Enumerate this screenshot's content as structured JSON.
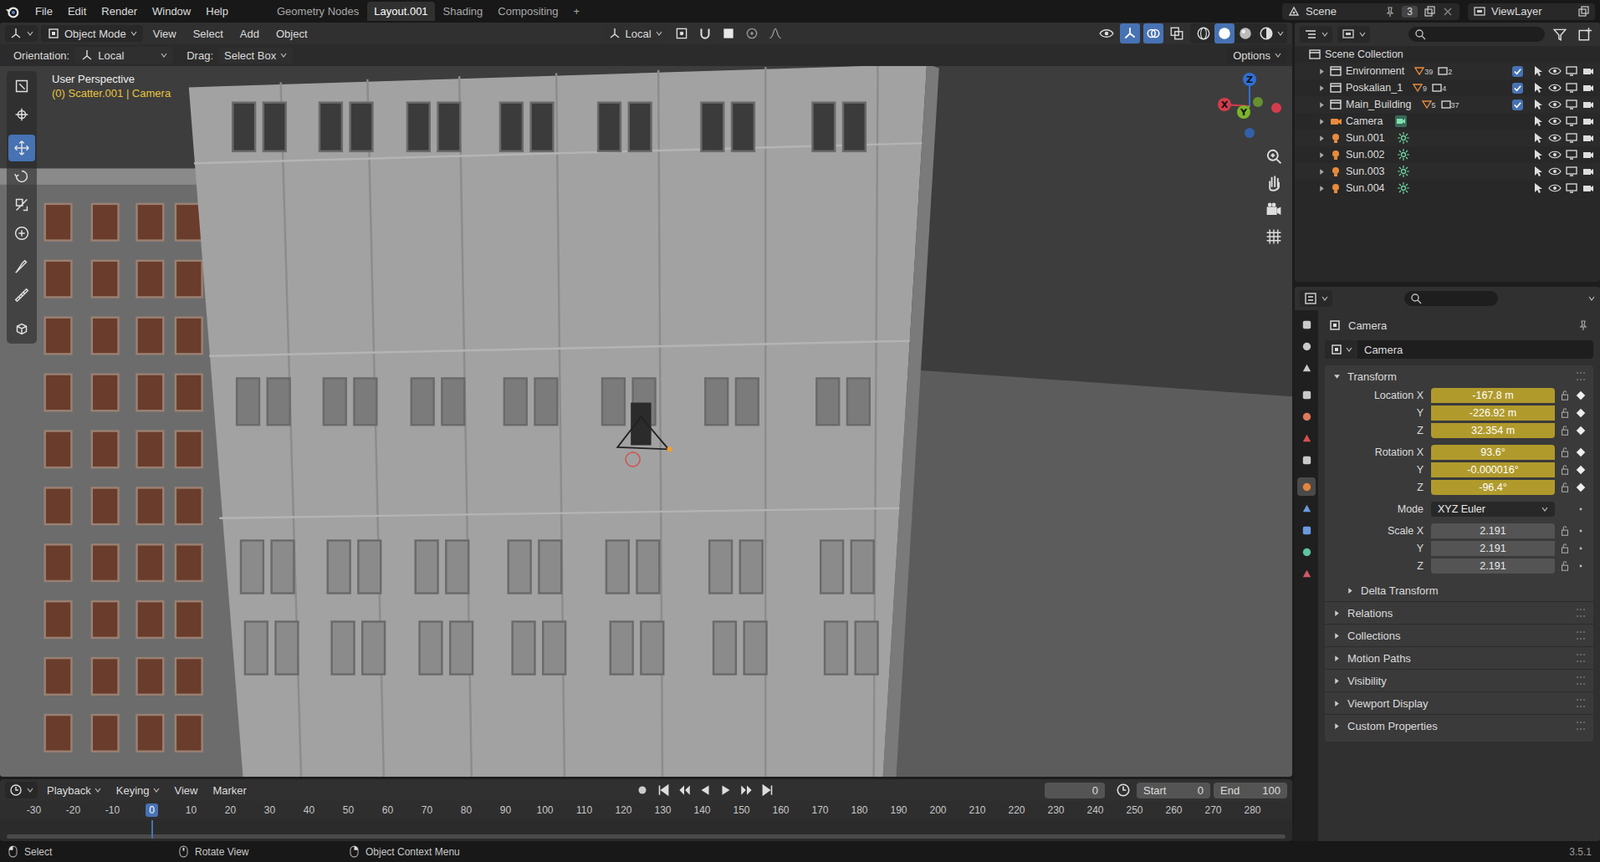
{
  "menu": [
    "File",
    "Edit",
    "Render",
    "Window",
    "Help"
  ],
  "workspaces": [
    {
      "label": "Geometry Nodes",
      "selected": false
    },
    {
      "label": "Layout.001",
      "selected": true
    },
    {
      "label": "Shading",
      "selected": false
    },
    {
      "label": "Compositing",
      "selected": false
    }
  ],
  "workspace_add": "+",
  "scene": {
    "label": "Scene",
    "count": "3",
    "view_layer": "ViewLayer"
  },
  "viewport_header": {
    "mode": "Object Mode",
    "menus": [
      "View",
      "Select",
      "Add",
      "Object"
    ],
    "orientation": "Local"
  },
  "tool_settings": {
    "orientation_label": "Orientation:",
    "orientation": "Local",
    "drag_label": "Drag:",
    "drag": "Select Box",
    "options": "Options"
  },
  "viewport": {
    "perspective": "User Perspective",
    "context": "(0) Scatter.001 | Camera",
    "axes": [
      "X",
      "Y",
      "Z"
    ]
  },
  "tools": [
    {
      "selected": false
    },
    {
      "selected": false
    },
    {
      "selected": true
    },
    {
      "selected": false
    },
    {
      "selected": false
    },
    {
      "selected": false
    },
    {
      "selected": false
    },
    {
      "selected": false
    },
    {
      "selected": false
    }
  ],
  "outliner": {
    "root": "Scene Collection",
    "items": [
      {
        "name": "Environment",
        "kind": "collection",
        "badges": [
          "39",
          "2"
        ],
        "checked": true
      },
      {
        "name": "Poskalian_1",
        "kind": "collection",
        "badges": [
          "9",
          "4"
        ],
        "checked": true
      },
      {
        "name": "Main_Building",
        "kind": "collection",
        "badges": [
          "5",
          "37"
        ],
        "checked": true
      },
      {
        "name": "Camera",
        "kind": "camera",
        "badges": []
      },
      {
        "name": "Sun.001",
        "kind": "light",
        "badges": []
      },
      {
        "name": "Sun.002",
        "kind": "light",
        "badges": []
      },
      {
        "name": "Sun.003",
        "kind": "light",
        "badges": []
      },
      {
        "name": "Sun.004",
        "kind": "light",
        "badges": []
      }
    ]
  },
  "properties": {
    "object": "Camera",
    "datablock": "Camera",
    "prop_tabs": [
      {
        "selected": false
      },
      {
        "selected": false
      },
      {
        "selected": false
      },
      {
        "selected": false
      },
      {
        "selected": false
      },
      {
        "selected": false
      },
      {
        "selected": false
      },
      {
        "selected": true
      },
      {
        "selected": false
      },
      {
        "selected": false
      },
      {
        "selected": false
      },
      {
        "selected": false
      }
    ],
    "transform": {
      "title": "Transform",
      "expanded": true,
      "groups": [
        {
          "rows": [
            {
              "label": "Location X",
              "value": "-167.8 m",
              "kind": "field",
              "animated": true
            },
            {
              "label": "Y",
              "value": "-226.92 m",
              "kind": "field",
              "animated": true
            },
            {
              "label": "Z",
              "value": "32.354 m",
              "kind": "field",
              "animated": true
            }
          ]
        },
        {
          "rows": [
            {
              "label": "Rotation X",
              "value": "93.6°",
              "kind": "field",
              "animated": true
            },
            {
              "label": "Y",
              "value": "-0.000016°",
              "kind": "field",
              "animated": true
            },
            {
              "label": "Z",
              "value": "-96.4°",
              "kind": "field",
              "animated": true
            }
          ]
        },
        {
          "rows": [
            {
              "label": "Mode",
              "value": "XYZ Euler",
              "kind": "dropdown",
              "animated": false
            }
          ]
        },
        {
          "rows": [
            {
              "label": "Scale X",
              "value": "2.191",
              "kind": "field",
              "animated": false
            },
            {
              "label": "Y",
              "value": "2.191",
              "kind": "field",
              "animated": false
            },
            {
              "label": "Z",
              "value": "2.191",
              "kind": "field",
              "animated": false
            }
          ]
        }
      ]
    },
    "sections": [
      {
        "label": "Delta Transform",
        "expanded": false,
        "sub": true
      },
      {
        "label": "Relations",
        "expanded": false,
        "sub": false
      },
      {
        "label": "Collections",
        "expanded": false,
        "sub": false
      },
      {
        "label": "Motion Paths",
        "expanded": false,
        "sub": false
      },
      {
        "label": "Visibility",
        "expanded": false,
        "sub": false
      },
      {
        "label": "Viewport Display",
        "expanded": false,
        "sub": false
      },
      {
        "label": "Custom Properties",
        "expanded": false,
        "sub": false
      }
    ]
  },
  "timeline": {
    "menus": [
      "Playback",
      "Keying",
      "View",
      "Marker"
    ],
    "current_frame": "0",
    "start_label": "Start",
    "start": "0",
    "end_label": "End",
    "end": "100",
    "ruler": [
      {
        "label": "-30",
        "selected": false
      },
      {
        "label": "-20",
        "selected": false
      },
      {
        "label": "-10",
        "selected": false
      },
      {
        "label": "0",
        "selected": true
      },
      {
        "label": "10",
        "selected": false
      },
      {
        "label": "20",
        "selected": false
      },
      {
        "label": "30",
        "selected": false
      },
      {
        "label": "40",
        "selected": false
      },
      {
        "label": "50",
        "selected": false
      },
      {
        "label": "60",
        "selected": false
      },
      {
        "label": "70",
        "selected": false
      },
      {
        "label": "80",
        "selected": false
      },
      {
        "label": "90",
        "selected": false
      },
      {
        "label": "100",
        "selected": false
      },
      {
        "label": "110",
        "selected": false
      },
      {
        "label": "120",
        "selected": false
      },
      {
        "label": "130",
        "selected": false
      },
      {
        "label": "140",
        "selected": false
      },
      {
        "label": "150",
        "selected": false
      },
      {
        "label": "160",
        "selected": false
      },
      {
        "label": "170",
        "selected": false
      },
      {
        "label": "180",
        "selected": false
      },
      {
        "label": "190",
        "selected": false
      },
      {
        "label": "200",
        "selected": false
      },
      {
        "label": "210",
        "selected": false
      },
      {
        "label": "220",
        "selected": false
      },
      {
        "label": "230",
        "selected": false
      },
      {
        "label": "240",
        "selected": false
      },
      {
        "label": "250",
        "selected": false
      },
      {
        "label": "260",
        "selected": false
      },
      {
        "label": "270",
        "selected": false
      },
      {
        "label": "280",
        "selected": false
      }
    ]
  },
  "status_bar": {
    "items": [
      "Select",
      "Rotate View",
      "Object Context Menu"
    ],
    "version": "3.5.1"
  }
}
